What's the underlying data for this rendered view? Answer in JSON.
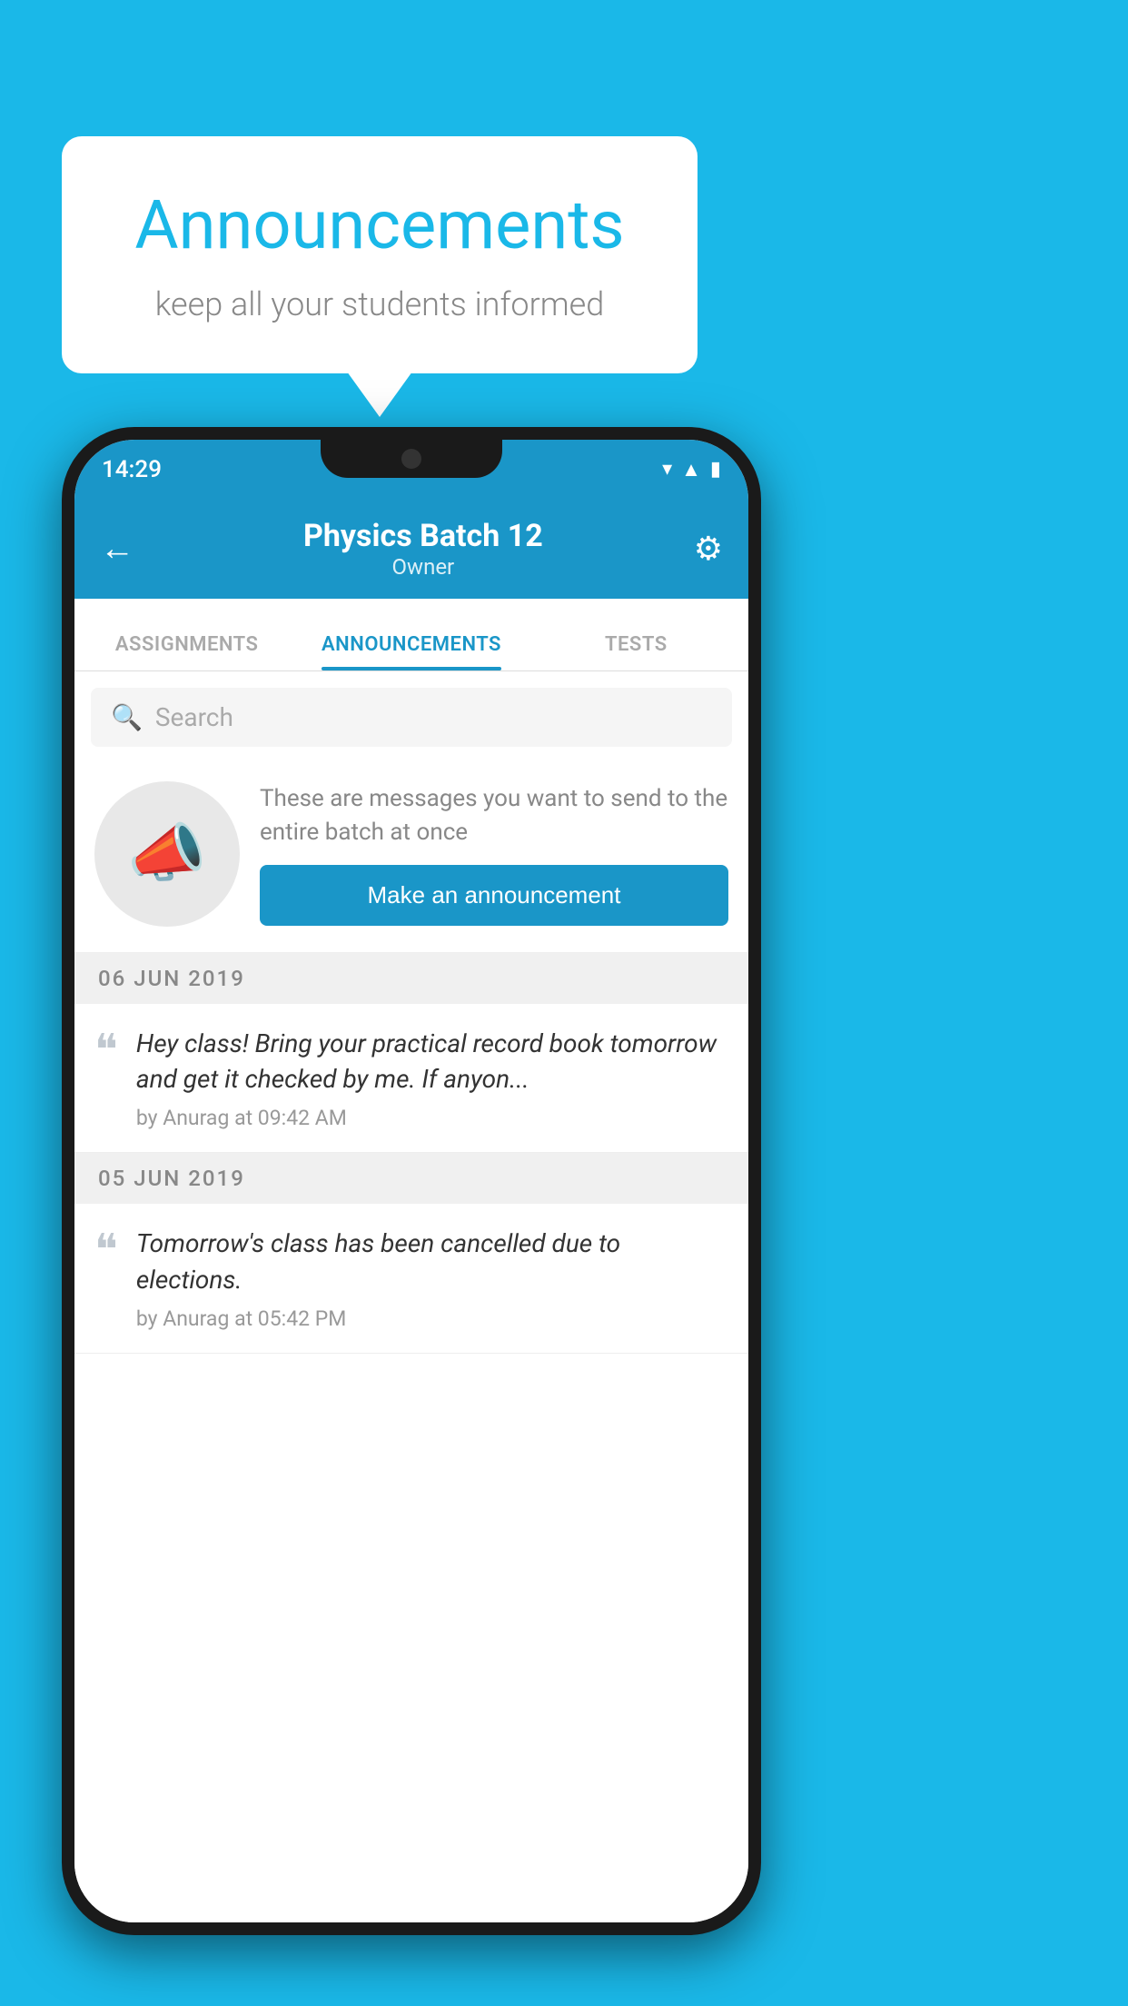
{
  "background_color": "#1ab8e8",
  "speech_bubble": {
    "title": "Announcements",
    "subtitle": "keep all your students informed"
  },
  "phone": {
    "status_bar": {
      "time": "14:29",
      "wifi_icon": "wifi",
      "signal_icon": "signal",
      "battery_icon": "battery"
    },
    "app_bar": {
      "back_label": "←",
      "title": "Physics Batch 12",
      "subtitle": "Owner",
      "settings_icon": "⚙"
    },
    "tabs": [
      {
        "label": "ASSIGNMENTS",
        "active": false
      },
      {
        "label": "ANNOUNCEMENTS",
        "active": true
      },
      {
        "label": "TESTS",
        "active": false
      }
    ],
    "search": {
      "placeholder": "Search"
    },
    "promo": {
      "description": "These are messages you want to send to the entire batch at once",
      "button_label": "Make an announcement"
    },
    "date_groups": [
      {
        "date": "06  JUN  2019",
        "announcements": [
          {
            "text": "Hey class! Bring your practical record book tomorrow and get it checked by me. If anyon...",
            "meta": "by Anurag at 09:42 AM"
          }
        ]
      },
      {
        "date": "05  JUN  2019",
        "announcements": [
          {
            "text": "Tomorrow's class has been cancelled due to elections.",
            "meta": "by Anurag at 05:42 PM"
          }
        ]
      }
    ]
  }
}
